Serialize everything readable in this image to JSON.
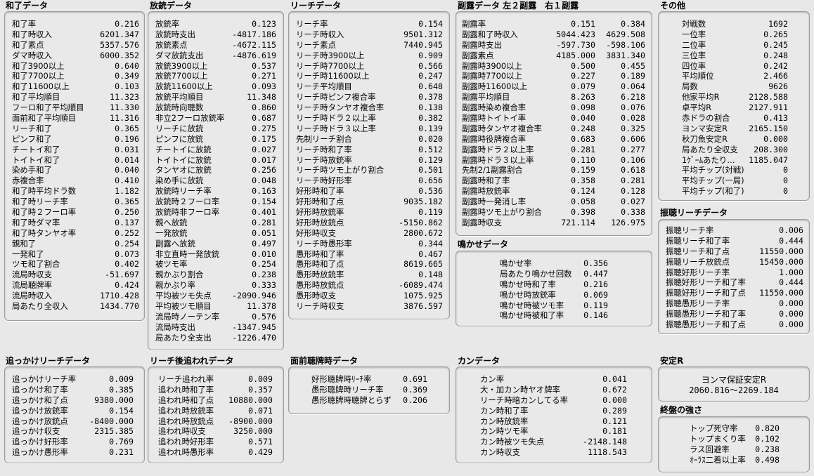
{
  "hora": {
    "title": "和了データ",
    "rows": [
      [
        "和了率",
        "0.216"
      ],
      [
        "和了時収入",
        "6201.347"
      ],
      [
        "和了素点",
        "5357.576"
      ],
      [
        "ダマ時収入",
        "6000.352"
      ],
      [
        "和了3900以上",
        "0.640"
      ],
      [
        "和了7700以上",
        "0.349"
      ],
      [
        "和了11600以上",
        "0.103"
      ],
      [
        "和了平均順目",
        "11.323"
      ],
      [
        "フーロ和了平均順目",
        "11.330"
      ],
      [
        "面前和了平均順目",
        "11.316"
      ],
      [
        "リーチ和了",
        "0.365"
      ],
      [
        "ピンフ和了",
        "0.196"
      ],
      [
        "チートイ和了",
        "0.031"
      ],
      [
        "トイトイ和了",
        "0.014"
      ],
      [
        "染め手和了",
        "0.040"
      ],
      [
        "赤複合率",
        "0.410"
      ],
      [
        "和了時平均ドラ数",
        "1.182"
      ],
      [
        "和了時リーチ率",
        "0.365"
      ],
      [
        "和了時２フーロ率",
        "0.250"
      ],
      [
        "和了時ダマ率",
        "0.137"
      ],
      [
        "和了時タンヤオ率",
        "0.252"
      ],
      [
        "親和了",
        "0.254"
      ],
      [
        "一発和了",
        "0.073"
      ],
      [
        "ツモ和了割合",
        "0.402"
      ],
      [
        "流局時収支",
        "-51.697"
      ],
      [
        "流局聴牌率",
        "0.424"
      ],
      [
        "流局時収入",
        "1710.428"
      ],
      [
        "局あたり全収入",
        "1434.770"
      ]
    ]
  },
  "deal_in": {
    "title": "放銃データ",
    "rows": [
      [
        "放銃率",
        "0.123"
      ],
      [
        "放銃時支出",
        "-4817.186"
      ],
      [
        "放銃素点",
        "-4672.115"
      ],
      [
        "ダマ放銃支出",
        "-4876.619"
      ],
      [
        "放銃3900以上",
        "0.537"
      ],
      [
        "放銃7700以上",
        "0.271"
      ],
      [
        "放銃11600以上",
        "0.093"
      ],
      [
        "放銃平均順目",
        "11.348"
      ],
      [
        "放銃時向聴数",
        "0.860"
      ],
      [
        "非立2フーロ放銃率",
        "0.687"
      ],
      [
        "リーチに放銃",
        "0.275"
      ],
      [
        "ピンフに放銃",
        "0.175"
      ],
      [
        "チートイに放銃",
        "0.027"
      ],
      [
        "トイトイに放銃",
        "0.017"
      ],
      [
        "タンヤオに放銃",
        "0.256"
      ],
      [
        "染め手に放銃",
        "0.048"
      ],
      [
        "放銃時リーチ率",
        "0.163"
      ],
      [
        "放銃時２フーロ率",
        "0.154"
      ],
      [
        "放銃時非フーロ率",
        "0.401"
      ],
      [
        "親へ放銃",
        "0.281"
      ],
      [
        "一発放銃",
        "0.051"
      ],
      [
        "副露へ放銃",
        "0.497"
      ],
      [
        "非立直時一発放銃",
        "0.010"
      ],
      [
        "被ツモ率",
        "0.254"
      ],
      [
        "親かぶり割合",
        "0.238"
      ],
      [
        "親かぶり率",
        "0.333"
      ],
      [
        "平均被ツモ失点",
        "-2090.946"
      ],
      [
        "平均被ツモ順目",
        "11.378"
      ],
      [
        "流局時ノーテン率",
        "0.576"
      ],
      [
        "流局時支出",
        "-1347.945"
      ],
      [
        "局あたり全支出",
        "-1226.470"
      ]
    ]
  },
  "riichi": {
    "title": "リーチデータ",
    "rows": [
      [
        "リーチ率",
        "0.154"
      ],
      [
        "リーチ時収入",
        "9501.312"
      ],
      [
        "リーチ素点",
        "7440.945"
      ],
      [
        "リーチ時3900以上",
        "0.909"
      ],
      [
        "リーチ時7700以上",
        "0.566"
      ],
      [
        "リーチ時11600以上",
        "0.247"
      ],
      [
        "リーチ平均順目",
        "0.648"
      ],
      [
        "リーチ時ピンフ複合率",
        "0.378"
      ],
      [
        "リーチ時タンヤオ複合率",
        "0.138"
      ],
      [
        "リーチ時ドラ２以上率",
        "0.382"
      ],
      [
        "リーチ時ドラ３以上率",
        "0.139"
      ],
      [
        "先制リーチ割合",
        "0.020"
      ],
      [
        "リーチ時和了率",
        "0.512"
      ],
      [
        "リーチ時放銃率",
        "0.129"
      ],
      [
        "リーチ時ツモ上がり割合",
        "0.501"
      ],
      [
        "リーチ時好形率",
        "0.656"
      ],
      [
        "好形時和了率",
        "0.536"
      ],
      [
        "好形時和了点",
        "9035.182"
      ],
      [
        "好形時放銃率",
        "0.119"
      ],
      [
        "好形時放銃点",
        "-5150.862"
      ],
      [
        "好形時収支",
        "2800.672"
      ],
      [
        "リーチ時愚形率",
        "0.344"
      ],
      [
        "愚形時和了率",
        "0.467"
      ],
      [
        "愚形時和了点",
        "8619.665"
      ],
      [
        "愚形時放銃率",
        "0.148"
      ],
      [
        "愚形時放銃点",
        "-6089.474"
      ],
      [
        "愚形時収支",
        "1075.925"
      ],
      [
        "リーチ時収支",
        "3876.597"
      ]
    ]
  },
  "furo": {
    "title": "副露データ 左２副露　右１副露",
    "rows": [
      [
        "副露率",
        "0.151",
        "0.384"
      ],
      [
        "副露和了時収入",
        "5044.423",
        "4629.508"
      ],
      [
        "副露時支出",
        "-597.730",
        "-598.106"
      ],
      [
        "副露素点",
        "4185.000",
        "3831.340"
      ],
      [
        "副露時3900以上",
        "0.500",
        "0.455"
      ],
      [
        "副露時7700以上",
        "0.227",
        "0.189"
      ],
      [
        "副露時11600以上",
        "0.079",
        "0.064"
      ],
      [
        "副露平均順目",
        "8.263",
        "6.218"
      ],
      [
        "副露時染め複合率",
        "0.098",
        "0.076"
      ],
      [
        "副露時トイトイ率",
        "0.040",
        "0.028"
      ],
      [
        "副露時タンヤオ複合率",
        "0.248",
        "0.325"
      ],
      [
        "副露時役牌複合率",
        "0.683",
        "0.606"
      ],
      [
        "副露時ドラ２以上率",
        "0.281",
        "0.277"
      ],
      [
        "副露時ドラ３以上率",
        "0.110",
        "0.106"
      ],
      [
        "先制2/1副露割合",
        "0.159",
        "0.618"
      ],
      [
        "副露時和了率",
        "0.358",
        "0.281"
      ],
      [
        "副露時放銃率",
        "0.124",
        "0.128"
      ],
      [
        "副露時一発消し率",
        "0.058",
        "0.027"
      ],
      [
        "副露時ツモ上がり割合",
        "0.398",
        "0.338"
      ],
      [
        "副露時収支",
        "721.114",
        "126.975"
      ]
    ]
  },
  "naki": {
    "title": "鳴かせデータ",
    "rows": [
      [
        "鳴かせ率",
        "0.356"
      ],
      [
        "局あたり鳴かせ回数",
        "0.447"
      ],
      [
        "鳴かせ時和了率",
        "0.216"
      ],
      [
        "鳴かせ時放銃率",
        "0.069"
      ],
      [
        "鳴かせ時被ツモ率",
        "0.119"
      ],
      [
        "鳴かせ時被和了率",
        "0.146"
      ]
    ]
  },
  "other": {
    "title": "その他",
    "rows": [
      [
        "対戦数",
        "1692"
      ],
      [
        "一位率",
        "0.265"
      ],
      [
        "二位率",
        "0.245"
      ],
      [
        "三位率",
        "0.248"
      ],
      [
        "四位率",
        "0.242"
      ],
      [
        "平均順位",
        "2.466"
      ],
      [
        "局数",
        "9626"
      ],
      [
        "他家平均R",
        "2128.588"
      ],
      [
        "卓平均R",
        "2127.911"
      ],
      [
        "赤ドラの割合",
        "0.413"
      ],
      [
        "ヨンマ安定R",
        "2165.150"
      ],
      [
        "秋刀魚安定R",
        "0.000"
      ],
      [
        "局あたり全収支",
        "208.300"
      ],
      [
        "1ｹﾞｰﾑあたり…",
        "1185.047"
      ],
      [
        "平均チップ(対戦)",
        "0"
      ],
      [
        "平均チップ(一局)",
        "0"
      ],
      [
        "平均チップ(和了)",
        "0"
      ]
    ]
  },
  "furiten": {
    "title": "振聴リーチデータ",
    "rows": [
      [
        "振聴リーチ率",
        "0.006"
      ],
      [
        "振聴リーチ和了率",
        "0.444"
      ],
      [
        "振聴リーチ和了点",
        "11550.000"
      ],
      [
        "振聴リーチ放銃点",
        "15450.000"
      ],
      [
        "振聴好形リーチ率",
        "1.000"
      ],
      [
        "振聴好形リーチ和了率",
        "0.444"
      ],
      [
        "振聴好形リーチ和了点",
        "11550.000"
      ],
      [
        "振聴愚形リーチ率",
        "0.000"
      ],
      [
        "振聴愚形リーチ和了率",
        "0.000"
      ],
      [
        "振聴愚形リーチ和了点",
        "0.000"
      ]
    ]
  },
  "chase": {
    "title": "追っかけリーチデータ",
    "rows": [
      [
        "追っかけリーチ率",
        "0.009"
      ],
      [
        "追っかけ和了率",
        "0.385"
      ],
      [
        "追っかけ和了点",
        "9380.000"
      ],
      [
        "追っかけ放銃率",
        "0.154"
      ],
      [
        "追っかけ放銃点",
        "-8400.000"
      ],
      [
        "追っかけ収支",
        "2315.385"
      ],
      [
        "追っかけ好形率",
        "0.769"
      ],
      [
        "追っかけ愚形率",
        "0.231"
      ]
    ]
  },
  "chased": {
    "title": "リーチ後追われデータ",
    "rows": [
      [
        "リーチ追われ率",
        "0.009"
      ],
      [
        "追われ時和了率",
        "0.357"
      ],
      [
        "追われ時和了点",
        "10880.000"
      ],
      [
        "追われ時放銃率",
        "0.071"
      ],
      [
        "追われ時放銃点",
        "-8900.000"
      ],
      [
        "追われ時収支",
        "3250.000"
      ],
      [
        "追われ時好形率",
        "0.571"
      ],
      [
        "追われ時愚形率",
        "0.429"
      ]
    ]
  },
  "menzen": {
    "title": "面前聴牌時データ",
    "rows": [
      [
        "好形聴牌時ﾘｰﾁ率",
        "0.691"
      ],
      [
        "愚形聴牌時リーチ率",
        "0.369"
      ],
      [
        "愚形聴牌時聴牌とらず",
        "0.206"
      ]
    ]
  },
  "kan": {
    "title": "カンデータ",
    "rows": [
      [
        "カン率",
        "0.041"
      ],
      [
        "大・加カン時ヤオ牌率",
        "0.672"
      ],
      [
        "リーチ時暗カンしてる率",
        "0.000"
      ],
      [
        "カン時和了率",
        "0.289"
      ],
      [
        "カン時放銃率",
        "0.121"
      ],
      [
        "カン時ツモ率",
        "0.181"
      ],
      [
        "カン時被ツモ失点",
        "-2148.148"
      ],
      [
        "カン時収支",
        "1118.543"
      ]
    ]
  },
  "stable": {
    "title": "安定R",
    "label": "ヨンマ保証安定R",
    "range": "2060.816〜2269.184"
  },
  "endgame": {
    "title": "終盤の強さ",
    "rows": [
      [
        "トップ死守率",
        "0.820"
      ],
      [
        "トップまくり率",
        "0.102"
      ],
      [
        "ラス回避率",
        "0.238"
      ],
      [
        "ｵｰﾗｽ二着以上率",
        "0.498"
      ]
    ]
  }
}
